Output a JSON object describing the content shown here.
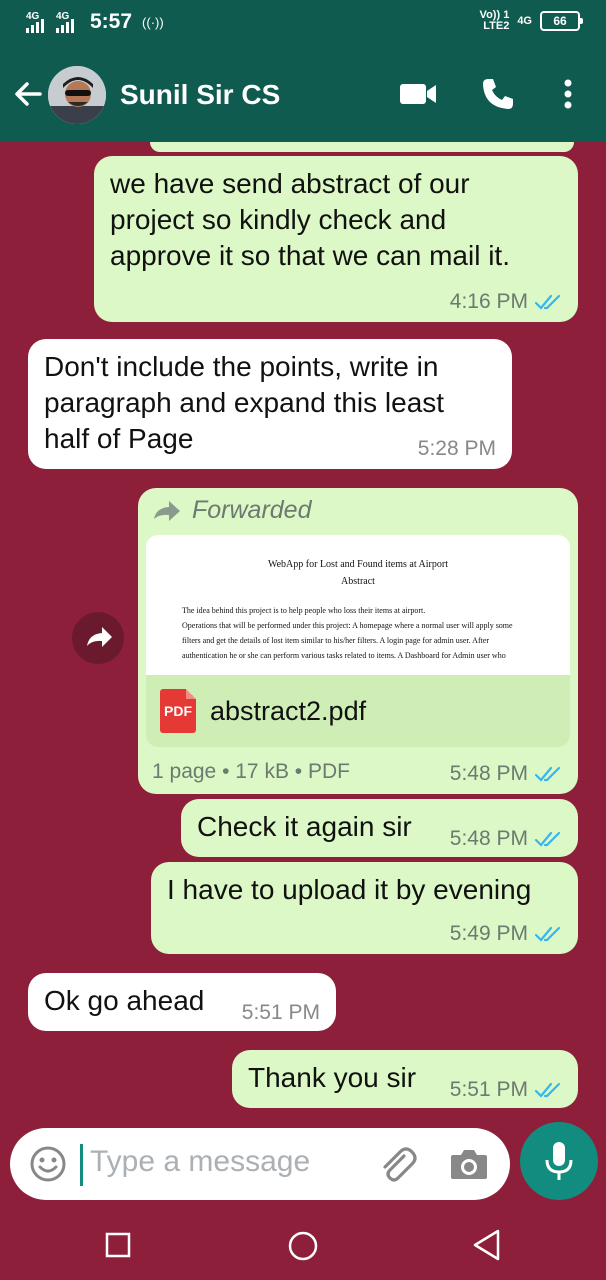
{
  "status_bar": {
    "sim1_label": "4G",
    "sim2_label": "4G",
    "time": "5:57",
    "volte_label": "Vo))",
    "sim_number": "1",
    "lte_label": "LTE2",
    "network_label": "4G",
    "battery_level": "66"
  },
  "header": {
    "contact_name": "Sunil Sir CS"
  },
  "messages": [
    {
      "direction": "outgoing",
      "text": "we have send abstract of our project so kindly check and approve it so that we can mail it.",
      "lines": [
        "we have send abstract of our",
        "project so kindly check and",
        "approve it so that we can mail it."
      ],
      "time": "4:16 PM",
      "status": "read"
    },
    {
      "direction": "incoming",
      "text": "Don't include the points, write in paragraph and expand this least half of Page",
      "lines": [
        "Don't include the points, write in",
        "paragraph and expand this least",
        "half of Page"
      ],
      "time": "5:28 PM"
    },
    {
      "direction": "outgoing",
      "type": "document",
      "forwarded_label": "Forwarded",
      "preview": {
        "title": "WebApp for Lost and Found items at Airport",
        "subtitle": "Abstract",
        "lines": [
          "The idea behind this project is to help people who loss their items at airport.",
          "Operations that will be performed under this project: A homepage where a normal user will apply some",
          "filters and get the details of lost item similar to his/her filters. A login page for admin user. After",
          "authentication he or she can perform various tasks related to items. A Dashboard for Admin user who"
        ]
      },
      "file_icon": "PDF",
      "file_name": "abstract2.pdf",
      "meta": "1 page • 17 kB • PDF",
      "time": "5:48 PM",
      "status": "read"
    },
    {
      "direction": "outgoing",
      "text": "Check it again sir",
      "time": "5:48 PM",
      "status": "read"
    },
    {
      "direction": "outgoing",
      "text": "I have to upload it by evening",
      "time": "5:49 PM",
      "status": "read"
    },
    {
      "direction": "incoming",
      "text": "Ok go ahead",
      "time": "5:51 PM"
    },
    {
      "direction": "outgoing",
      "text": "Thank you sir",
      "time": "5:51 PM",
      "status": "read"
    }
  ],
  "input": {
    "placeholder": "Type a message"
  },
  "colors": {
    "header": "#0f5b50",
    "wallpaper": "#8e1f3a",
    "outgoing_bubble": "#dcf8c6",
    "incoming_bubble": "#ffffff",
    "read_ticks": "#34b7f1",
    "accent": "#128c7e"
  },
  "icons": {
    "back": "arrow-left-icon",
    "video": "video-camera-icon",
    "call": "phone-icon",
    "menu": "more-vertical-icon",
    "forward": "forward-arrow-icon",
    "emoji": "emoji-icon",
    "attach": "paperclip-icon",
    "camera": "camera-icon",
    "mic": "microphone-icon"
  }
}
